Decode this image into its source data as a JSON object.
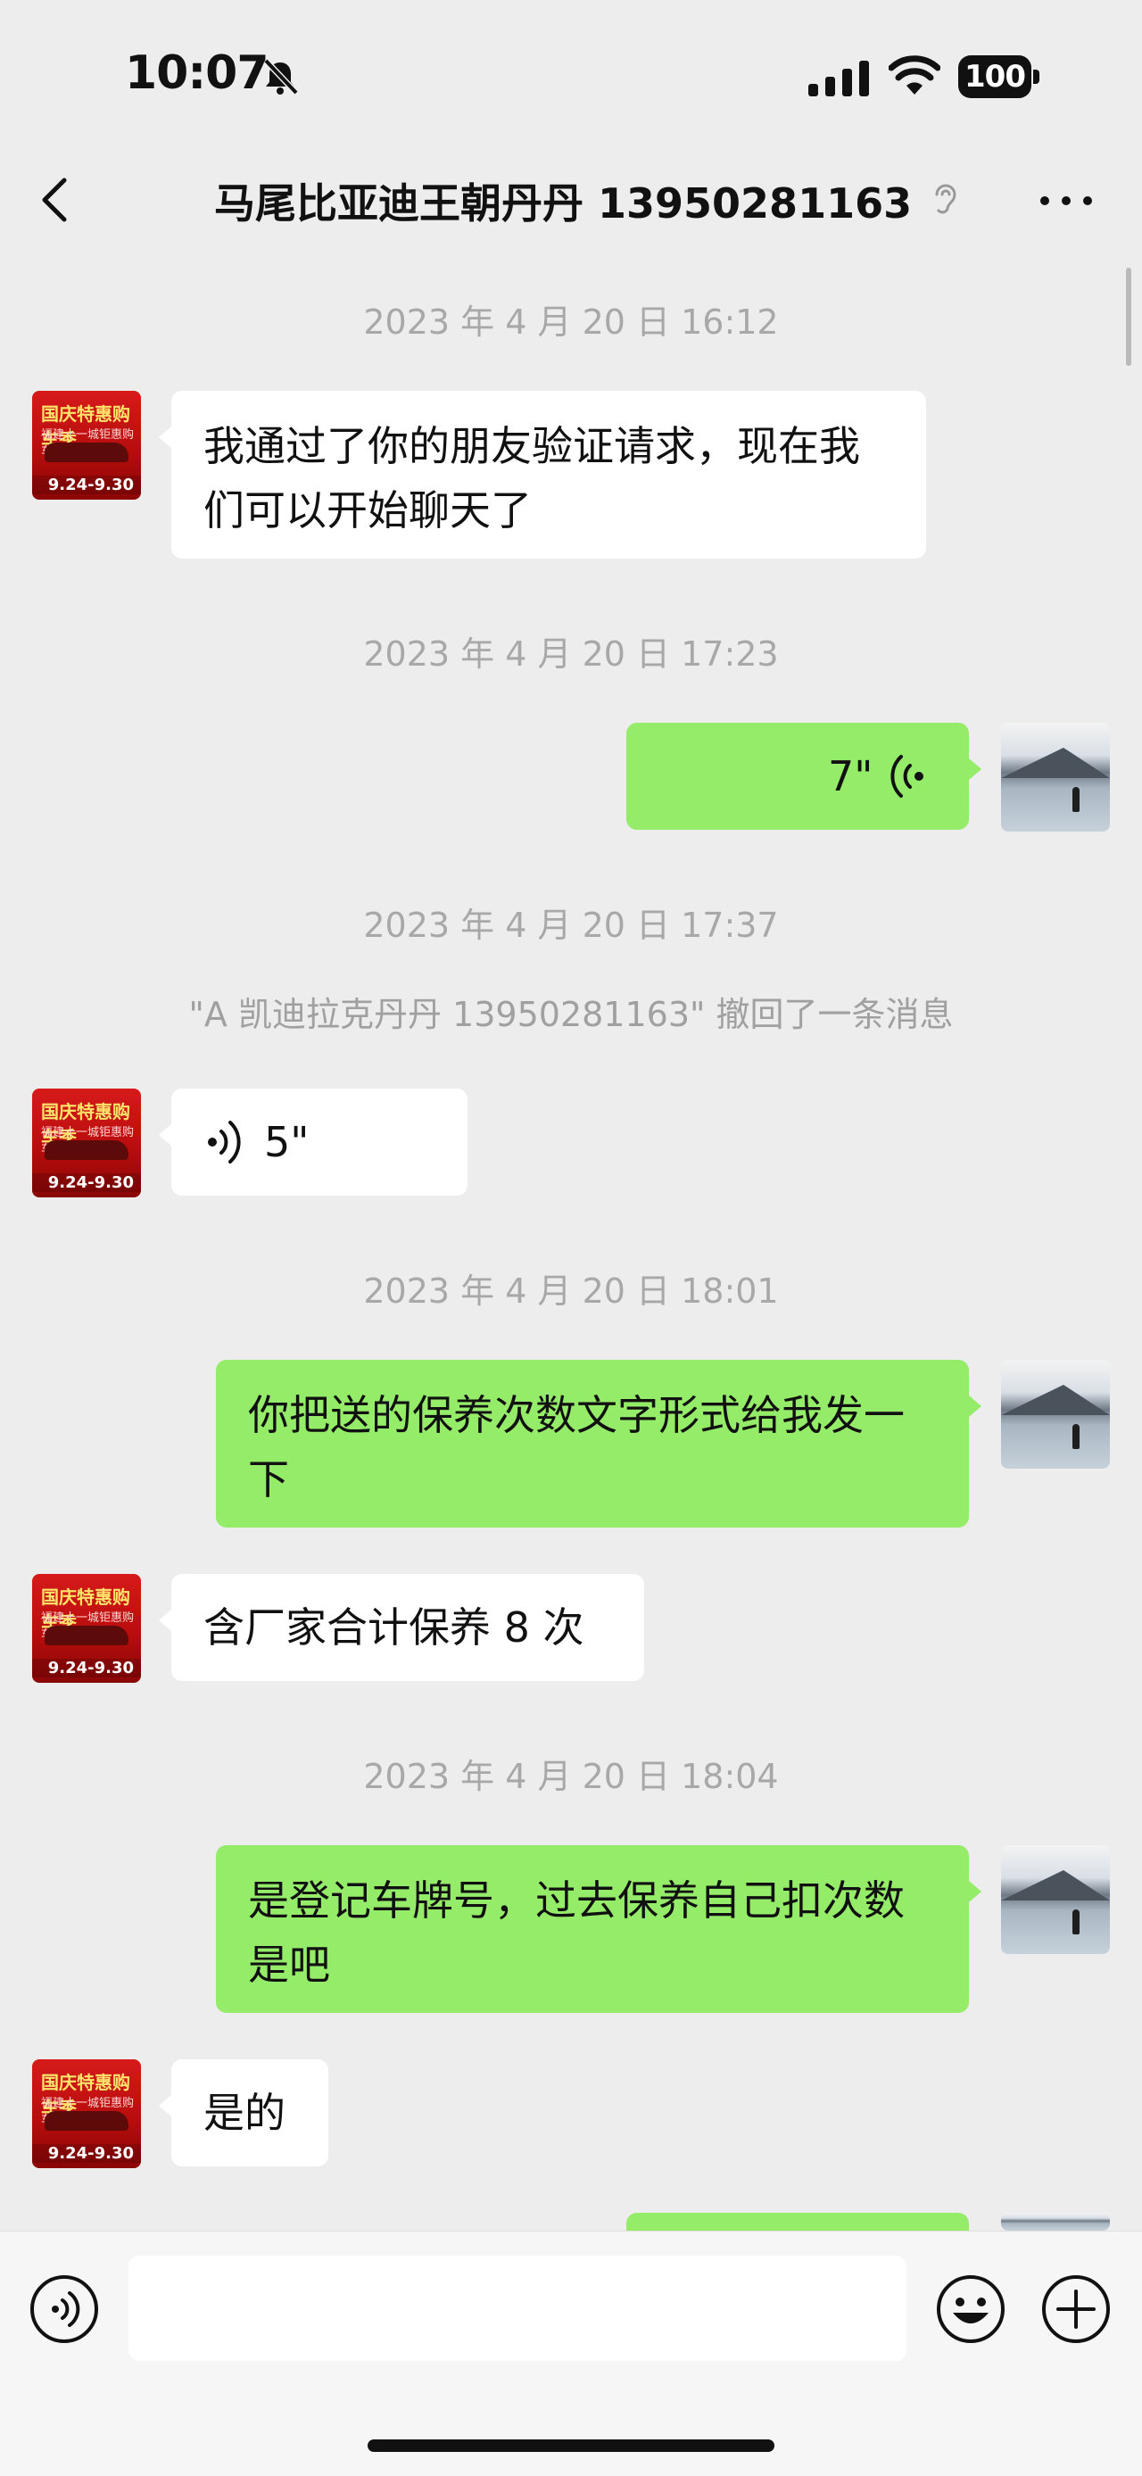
{
  "status_bar": {
    "time": "10:07",
    "battery": "100"
  },
  "header": {
    "title": "马尾比亚迪王朝丹丹 13950281163"
  },
  "contact_avatar": {
    "title": "国庆特惠购车季",
    "subtitle": "福建十一城钜惠购车盛宴",
    "date": "9.24-9.30"
  },
  "messages": {
    "t1": "2023 年 4 月 20 日 16:12",
    "m1": "我通过了你的朋友验证请求，现在我们可以开始聊天了",
    "t2": "2023 年 4 月 20 日 17:23",
    "m2_duration": "7\"",
    "t3": "2023 年 4 月 20 日 17:37",
    "recall": "\"A 凯迪拉克丹丹 13950281163\" 撤回了一条消息",
    "m3_duration": "5\"",
    "t4": "2023 年 4 月 20 日 18:01",
    "m4": "你把送的保养次数文字形式给我发一下",
    "m5": "含厂家合计保养 8 次",
    "t5": "2023 年 4 月 20 日 18:04",
    "m6": "是登记车牌号，过去保养自己扣次数是吧",
    "m7": "是的"
  },
  "colors": {
    "outgoing_bubble": "#95ec69",
    "incoming_bubble": "#ffffff",
    "background": "#ededed"
  }
}
